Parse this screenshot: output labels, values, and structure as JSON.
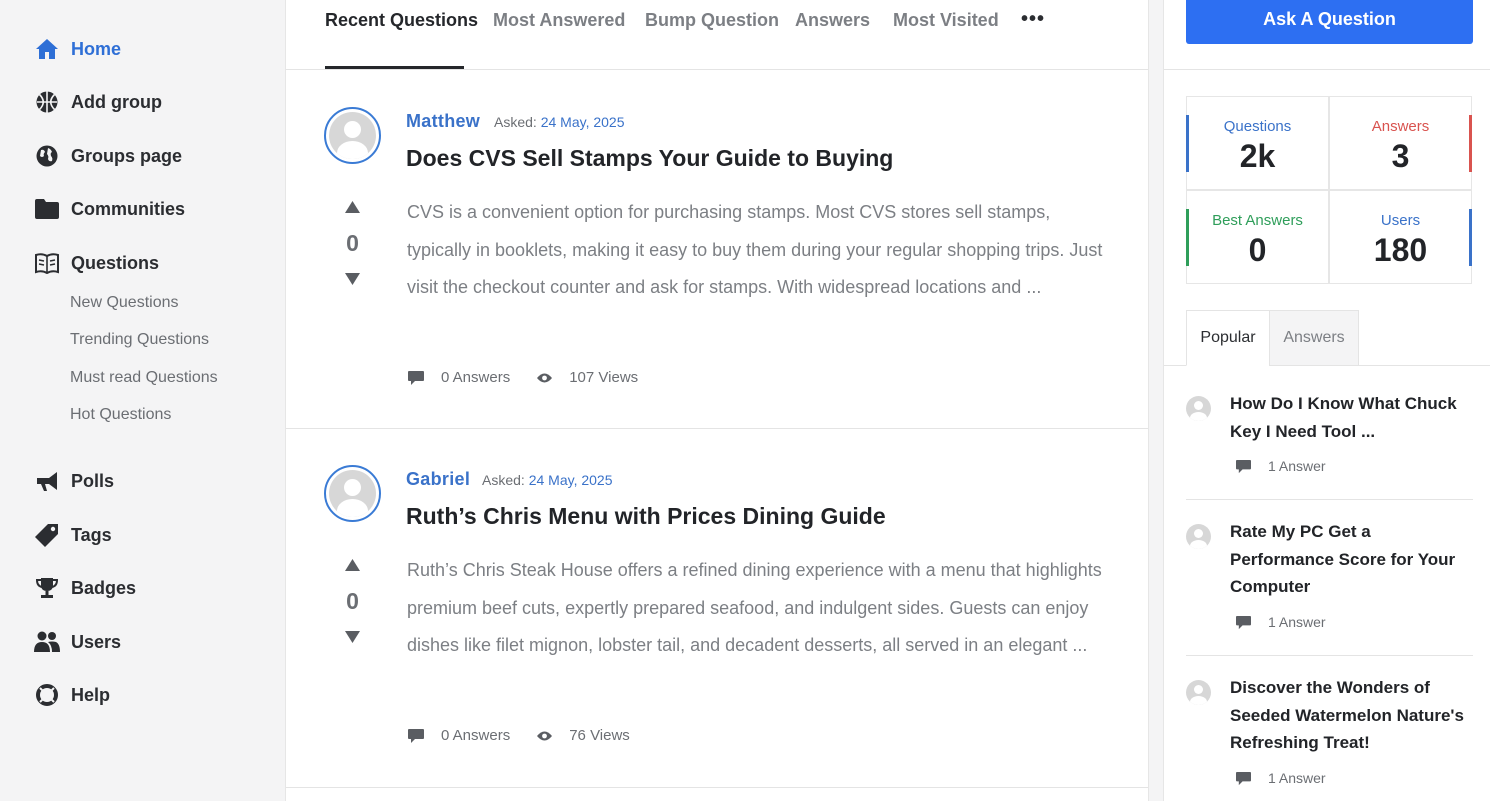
{
  "sidebar": {
    "items": [
      {
        "label": "Home",
        "icon": "home-icon"
      },
      {
        "label": "Add group",
        "icon": "basketball-icon"
      },
      {
        "label": "Groups page",
        "icon": "globe-icon"
      },
      {
        "label": "Communities",
        "icon": "folder-icon"
      },
      {
        "label": "Questions",
        "icon": "book-icon"
      }
    ],
    "sub_items": [
      "New Questions",
      "Trending Questions",
      "Must read Questions",
      "Hot Questions"
    ],
    "items2": [
      {
        "label": "Polls",
        "icon": "megaphone-icon"
      },
      {
        "label": "Tags",
        "icon": "tag-icon"
      },
      {
        "label": "Badges",
        "icon": "trophy-icon"
      },
      {
        "label": "Users",
        "icon": "users-icon"
      },
      {
        "label": "Help",
        "icon": "lifebuoy-icon"
      }
    ],
    "active": "Home",
    "accent": "#2e6fd6"
  },
  "tabs": [
    "Recent Questions",
    "Most Answered",
    "Bump Question",
    "Answers",
    "Most Visited"
  ],
  "tabs_more": "•••",
  "questions": [
    {
      "author": "Matthew",
      "asked_label": "Asked:",
      "date": "24 May, 2025",
      "title": "Does CVS Sell Stamps Your Guide to Buying",
      "votes": "0",
      "excerpt": "CVS is a convenient option for purchasing stamps. Most CVS stores sell stamps, typically in booklets, making it easy to buy them during your regular shopping trips. Just visit the checkout counter and ask for stamps. With widespread locations and ...",
      "answers": "0 Answers",
      "views_count": "107",
      "views_label": "Views"
    },
    {
      "author": "Gabriel",
      "asked_label": "Asked:",
      "date": "24 May, 2025",
      "title": "Ruth’s Chris Menu with Prices Dining Guide",
      "votes": "0",
      "excerpt": "Ruth’s Chris Steak House offers a refined dining experience with a menu that highlights premium beef cuts, expertly prepared seafood, and indulgent sides. Guests can enjoy dishes like filet mignon, lobster tail, and decadent desserts, all served in an elegant ...",
      "answers": "0 Answers",
      "views_count": "76",
      "views_label": "Views"
    }
  ],
  "right": {
    "ask_button": "Ask A Question",
    "stats": [
      {
        "label": "Questions",
        "value": "2k",
        "color": "#3a72c9"
      },
      {
        "label": "Answers",
        "value": "3",
        "color": "#d9534f"
      },
      {
        "label": "Best Answers",
        "value": "0",
        "color": "#2f9e5a"
      },
      {
        "label": "Users",
        "value": "180",
        "color": "#3a72c9"
      }
    ],
    "tabs": [
      "Popular",
      "Answers"
    ],
    "popular": [
      {
        "title": "How Do I Know What Chuck Key I Need Tool ...",
        "answers": "1 Answer"
      },
      {
        "title": "Rate My PC Get a Performance Score for Your Computer",
        "answers": "1 Answer"
      },
      {
        "title": "Discover the Wonders of Seeded Watermelon Nature's Refreshing Treat!",
        "answers": "1 Answer"
      }
    ]
  }
}
